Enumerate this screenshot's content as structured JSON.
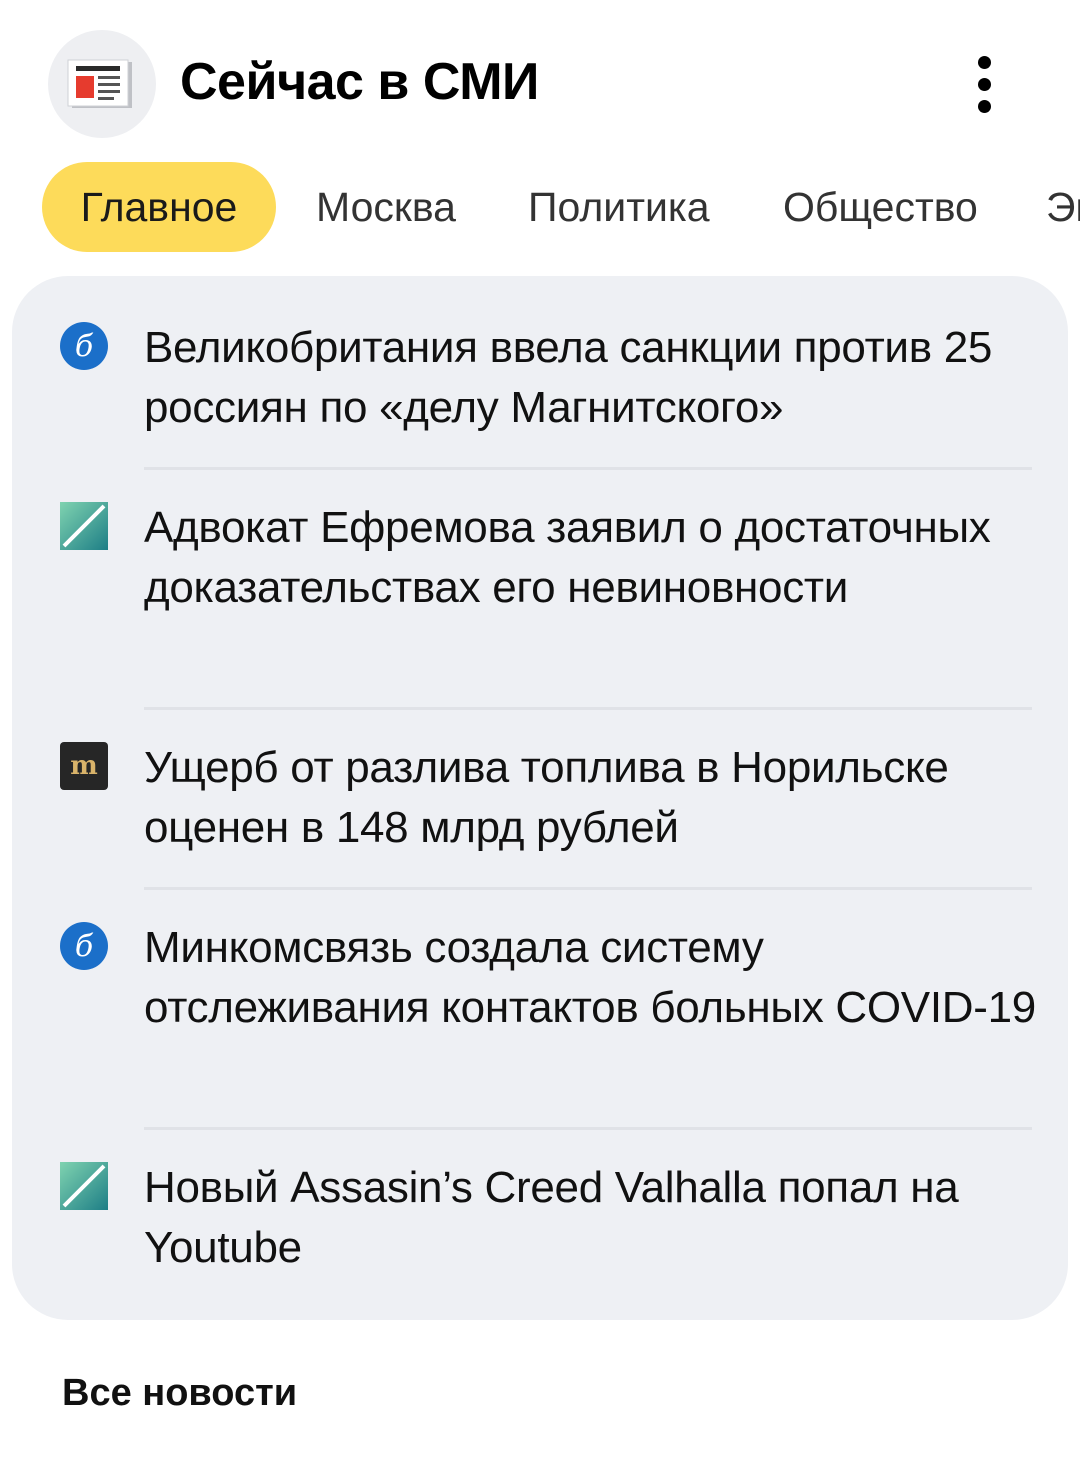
{
  "header": {
    "title": "Сейчас в СМИ",
    "logo_icon": "newspaper-icon",
    "menu_icon": "more-vertical-icon"
  },
  "tabs": [
    {
      "label": "Главное",
      "active": true
    },
    {
      "label": "Москва",
      "active": false
    },
    {
      "label": "Политика",
      "active": false
    },
    {
      "label": "Общество",
      "active": false
    },
    {
      "label": "Эк",
      "active": false
    }
  ],
  "news": [
    {
      "title": "Великобритания ввела санкции против 25 россиян по «делу Магнитского»",
      "source_icon": "source-blue-circle-icon"
    },
    {
      "title": "Адвокат Ефремова заявил о достаточных доказательствах его невиновности",
      "source_icon": "source-green-teal-icon"
    },
    {
      "title": "Ущерб от разлива топлива в Норильске оценен в 148 млрд рублей",
      "source_icon": "source-m-dark-icon"
    },
    {
      "title": "Минкомсвязь создала систему отслеживания контактов больных COVID-19",
      "source_icon": "source-blue-circle-icon"
    },
    {
      "title": "Новый Assasin’s Creed Valhalla попал на Youtube",
      "source_icon": "source-green-teal-icon"
    }
  ],
  "footer": {
    "all_news_label": "Все новости"
  },
  "colors": {
    "active_tab": "#fddb5a",
    "card_bg": "#eef0f4",
    "logo_red": "#e63b2e"
  }
}
